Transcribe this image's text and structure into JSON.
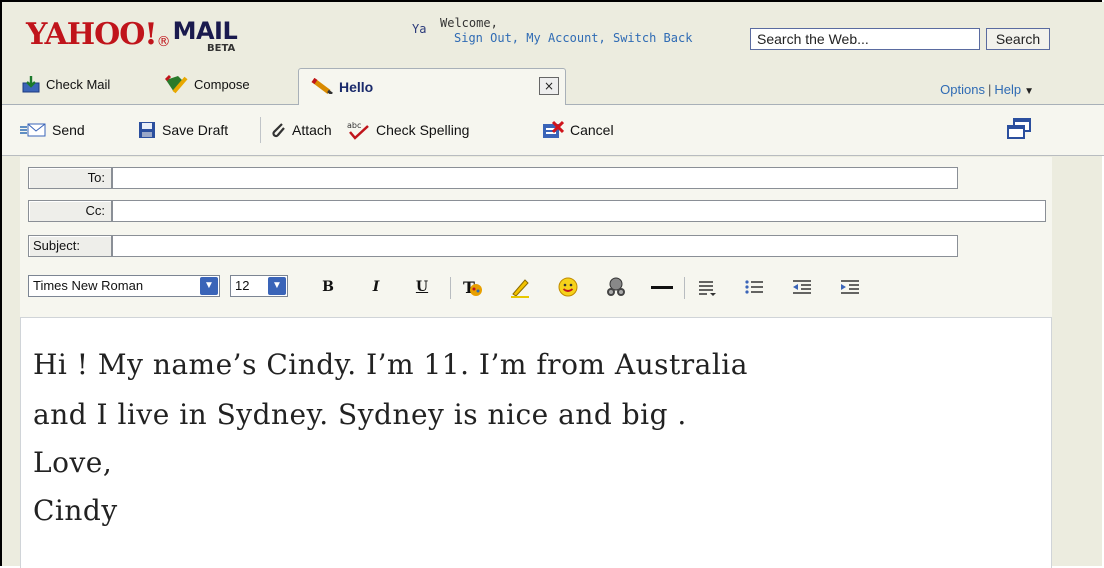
{
  "header": {
    "logo_text": "YAHOO!",
    "logo_mail": "MAIL",
    "logo_beta": "BETA",
    "welcome_prefix": "Ya",
    "welcome_line1": "Welcome,",
    "welcome_links": [
      "Sign Out,",
      "My Account,",
      "Switch Back"
    ],
    "search_placeholder": "Search the Web...",
    "search_button": "Search"
  },
  "tabs": {
    "check_mail": "Check Mail",
    "compose": "Compose",
    "active_title": "Hello",
    "close_glyph": "×",
    "options": "Options",
    "help": "Help"
  },
  "toolbar": {
    "send": "Send",
    "save_draft": "Save Draft",
    "attach": "Attach",
    "check_spelling": "Check Spelling",
    "cancel": "Cancel"
  },
  "fields": {
    "to_label": "To:",
    "cc_label": "Cc:",
    "subject_label": "Subject:",
    "to_value": "",
    "cc_value": "",
    "subject_value": ""
  },
  "format": {
    "font_family": "Times New Roman",
    "font_size": "12",
    "bold": "B",
    "italic": "I",
    "underline": "U"
  },
  "message": {
    "lines": [
      "Hi ! My name’s Cindy. I’m 11. I’m from Australia",
      "and I live in Sydney. Sydney is nice and big .",
      "Love,",
      "Cindy"
    ]
  },
  "colors": {
    "brand_red": "#c0141b",
    "link_blue": "#2f6bb4",
    "chrome_bg": "#ececdf"
  }
}
